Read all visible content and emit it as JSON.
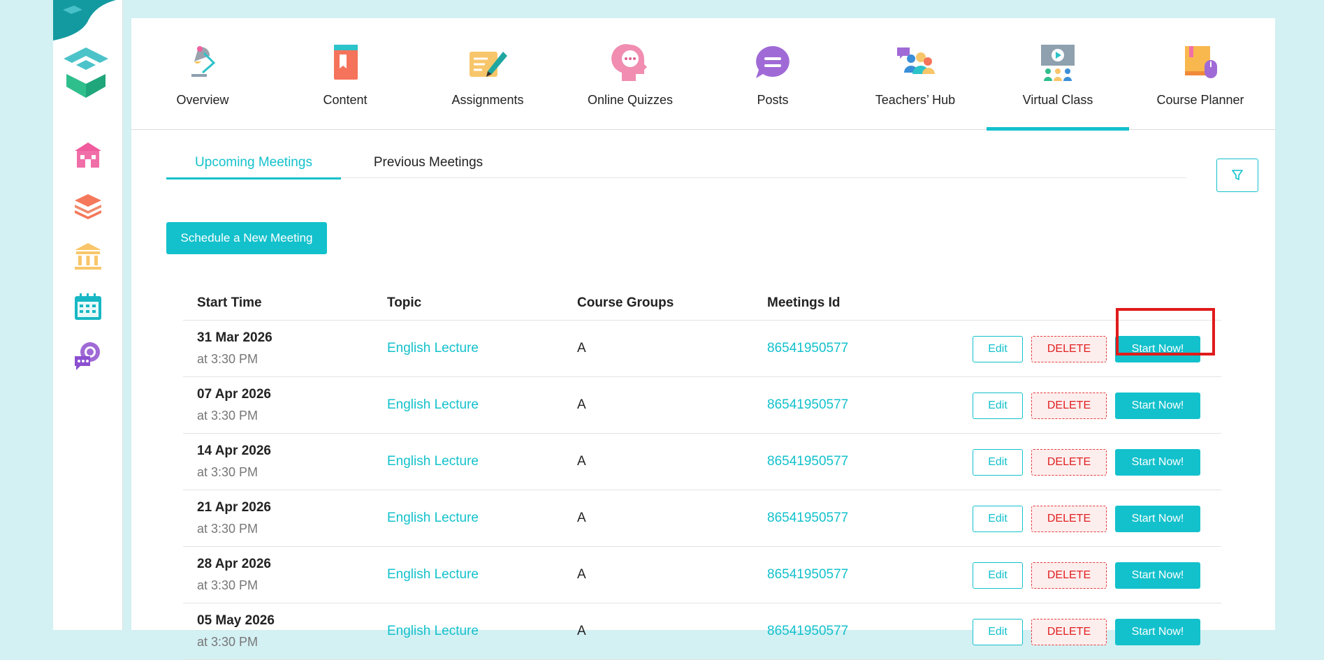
{
  "nav": {
    "items": [
      {
        "label": "Overview"
      },
      {
        "label": "Content"
      },
      {
        "label": "Assignments"
      },
      {
        "label": "Online Quizzes"
      },
      {
        "label": "Posts"
      },
      {
        "label": "Teachers’ Hub"
      },
      {
        "label": "Virtual Class"
      },
      {
        "label": "Course Planner"
      }
    ],
    "active": "Virtual Class"
  },
  "sidebar": {
    "icons": [
      "school-icon",
      "courses-stack-icon",
      "institution-icon",
      "calendar-icon",
      "chat-icon"
    ]
  },
  "tabs": {
    "upcoming": "Upcoming Meetings",
    "previous": "Previous Meetings"
  },
  "schedule_button": "Schedule a New Meeting",
  "table": {
    "headers": {
      "start_time": "Start Time",
      "topic": "Topic",
      "course_groups": "Course Groups",
      "meetings_id": "Meetings Id"
    },
    "rows": [
      {
        "date": "31 Mar 2026",
        "time": "at 3:30 PM",
        "topic": "English Lecture",
        "group": "A",
        "id": "86541950577"
      },
      {
        "date": "07 Apr 2026",
        "time": "at 3:30 PM",
        "topic": "English Lecture",
        "group": "A",
        "id": "86541950577"
      },
      {
        "date": "14 Apr 2026",
        "time": "at 3:30 PM",
        "topic": "English Lecture",
        "group": "A",
        "id": "86541950577"
      },
      {
        "date": "21 Apr 2026",
        "time": "at 3:30 PM",
        "topic": "English Lecture",
        "group": "A",
        "id": "86541950577"
      },
      {
        "date": "28 Apr 2026",
        "time": "at 3:30 PM",
        "topic": "English Lecture",
        "group": "A",
        "id": "86541950577"
      },
      {
        "date": "05 May 2026",
        "time": "at 3:30 PM",
        "topic": "English Lecture",
        "group": "A",
        "id": "86541950577"
      }
    ],
    "actions": {
      "edit": "Edit",
      "delete": "DELETE",
      "start": "Start Now!"
    }
  },
  "colors": {
    "accent": "#13c1cc",
    "background": "#d3f0f3",
    "delete": "#e02020",
    "highlight": "#e01b1b"
  }
}
